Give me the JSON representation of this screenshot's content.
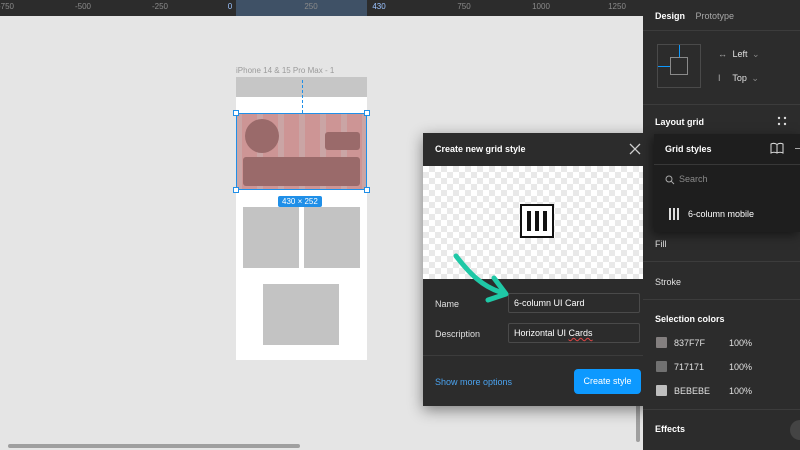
{
  "ruler": {
    "ticks": [
      "-750",
      "-500",
      "-250",
      "0",
      "250",
      "430",
      "750",
      "1000",
      "1250"
    ],
    "highlight_start": "0",
    "highlight_end": "430"
  },
  "canvas": {
    "frame_label": "iPhone 14 & 15 Pro Max - 1",
    "selection_size": "430 × 252"
  },
  "dialog": {
    "title": "Create new grid style",
    "name_label": "Name",
    "name_value": "6-column UI Card",
    "description_label": "Description",
    "description_value_prefix": "Horizontal UI ",
    "description_value_flagged": "Cards",
    "more_options": "Show more options",
    "create_button": "Create style"
  },
  "panel": {
    "tabs": [
      "Design",
      "Prototype"
    ],
    "constraint_h": "Left",
    "constraint_v": "Top",
    "layout_grid": "Layout grid",
    "grid_styles": {
      "title": "Grid styles",
      "search_placeholder": "Search",
      "item": "6-column mobile"
    },
    "fill": "Fill",
    "stroke": "Stroke",
    "selection_colors_title": "Selection colors",
    "selection_colors": [
      {
        "hex": "837F7F",
        "opacity": "100%",
        "color": "#837f7f"
      },
      {
        "hex": "717171",
        "opacity": "100%",
        "color": "#717171"
      },
      {
        "hex": "BEBEBE",
        "opacity": "100%",
        "color": "#bebebe"
      }
    ],
    "effects": "Effects"
  },
  "colors": {
    "accent": "#0d99ff",
    "selection": "#1f8fe8",
    "arrow": "#1fc8a6"
  }
}
